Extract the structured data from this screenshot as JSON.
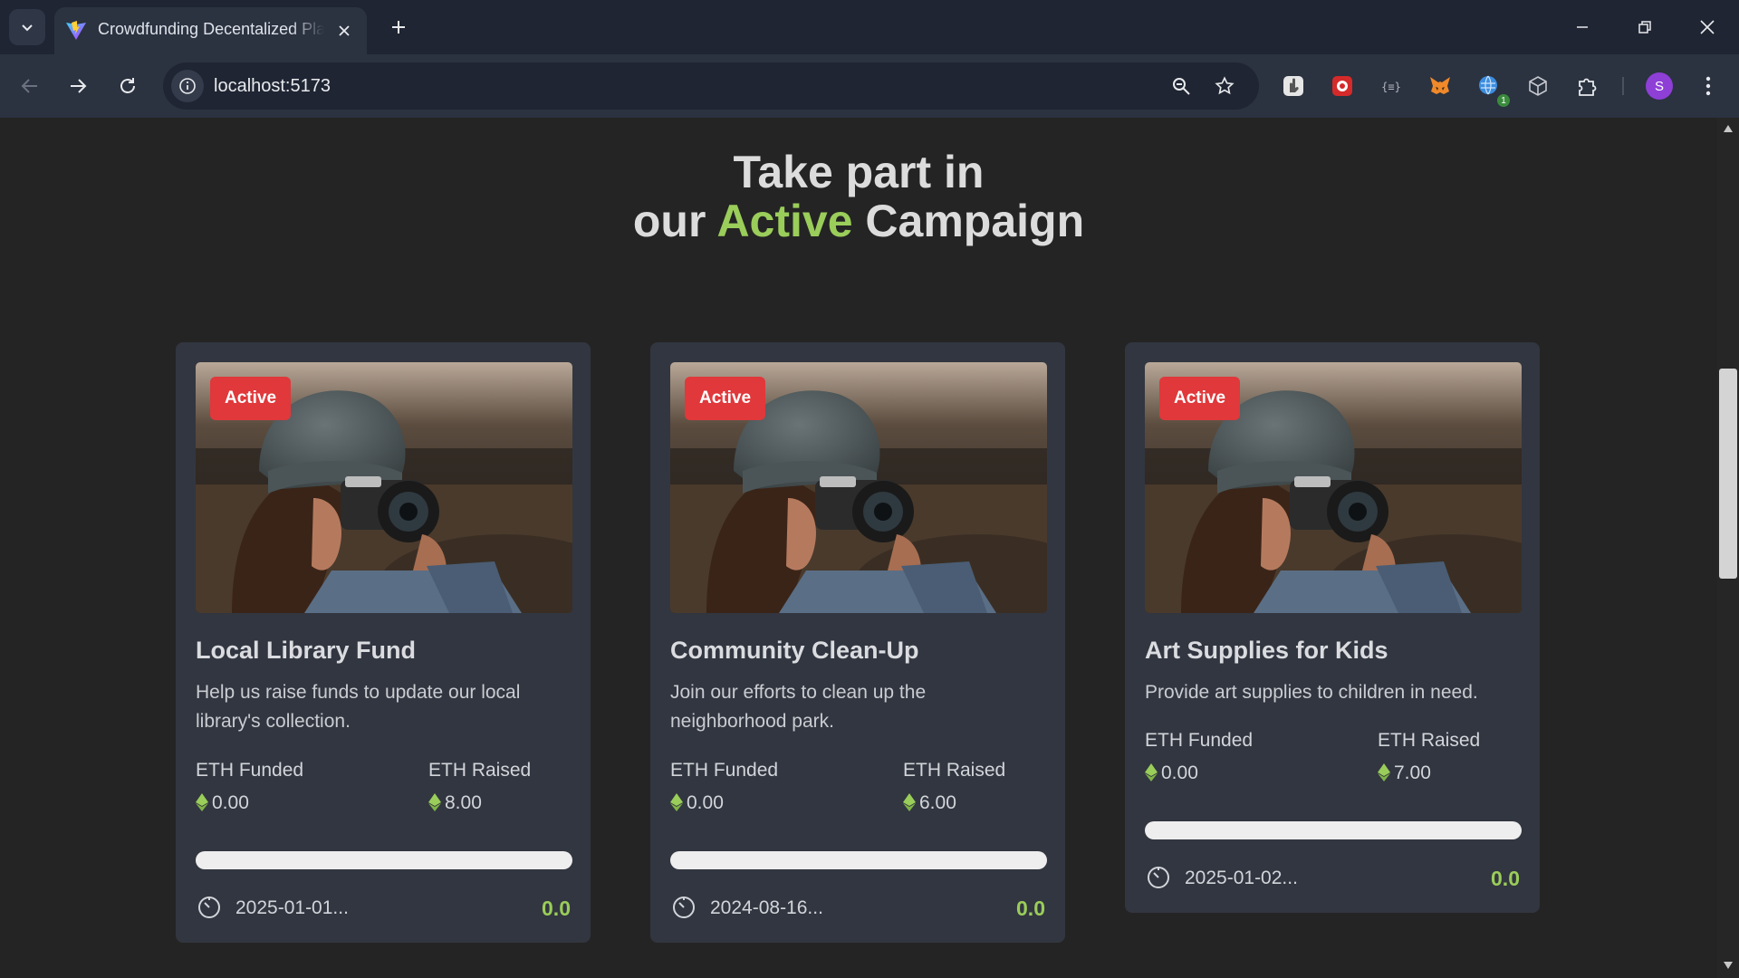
{
  "browser": {
    "tab_title": "Crowdfunding Decentalized Platform",
    "url": "localhost:5173",
    "extension_badge": "1",
    "profile_initial": "S"
  },
  "page": {
    "heading_line1": "Take part in",
    "heading_pre": "our ",
    "heading_accent": "Active",
    "heading_post": " Campaign",
    "accent_color": "#9acd5a",
    "status_color": "#e0383b"
  },
  "campaigns": [
    {
      "status": "Active",
      "title": "Local Library Fund",
      "description": "Help us raise funds to update our local library's collection.",
      "funded_label": "ETH Funded",
      "funded_value": "0.00",
      "raised_label": "ETH Raised",
      "raised_value": "8.00",
      "progress": 0,
      "deadline": "2025-01-01...",
      "percent": "0.0"
    },
    {
      "status": "Active",
      "title": "Community Clean-Up",
      "description": "Join our efforts to clean up the neighborhood park.",
      "funded_label": "ETH Funded",
      "funded_value": "0.00",
      "raised_label": "ETH Raised",
      "raised_value": "6.00",
      "progress": 0,
      "deadline": "2024-08-16...",
      "percent": "0.0"
    },
    {
      "status": "Active",
      "title": "Art Supplies for Kids",
      "description": "Provide art supplies to children in need.",
      "funded_label": "ETH Funded",
      "funded_value": "0.00",
      "raised_label": "ETH Raised",
      "raised_value": "7.00",
      "progress": 0,
      "deadline": "2025-01-02...",
      "percent": "0.0"
    }
  ]
}
